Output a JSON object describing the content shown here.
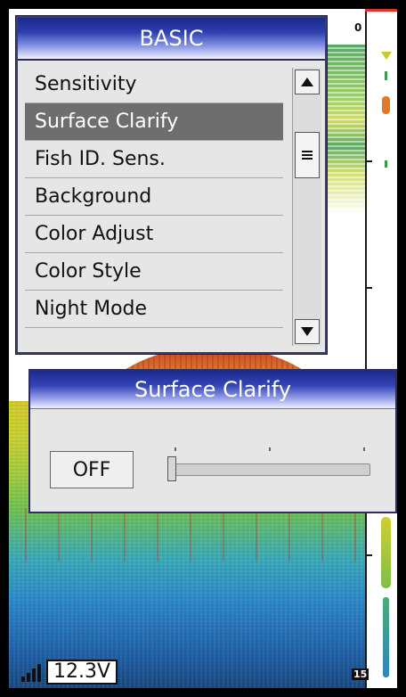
{
  "menu": {
    "title": "BASIC",
    "items": [
      {
        "label": "Sensitivity"
      },
      {
        "label": "Surface Clarify"
      },
      {
        "label": "Fish ID. Sens."
      },
      {
        "label": "Background"
      },
      {
        "label": "Color Adjust"
      },
      {
        "label": "Color Style"
      },
      {
        "label": "Night Mode"
      }
    ],
    "selected_index": 1,
    "scroll_up_icon": "triangle-up-icon",
    "scroll_down_icon": "triangle-down-icon"
  },
  "dialog": {
    "title": "Surface Clarify",
    "value": "OFF",
    "slider_level": 0
  },
  "depth": {
    "top_label": "0",
    "bottom_label": "15"
  },
  "status": {
    "voltage": "12.3V",
    "signal_icon": "signal-bars-icon"
  },
  "colors": {
    "header_blue": "#2d3fb0",
    "selected_bg": "#6e6e6e",
    "depth_top_line": "#e0322a"
  }
}
